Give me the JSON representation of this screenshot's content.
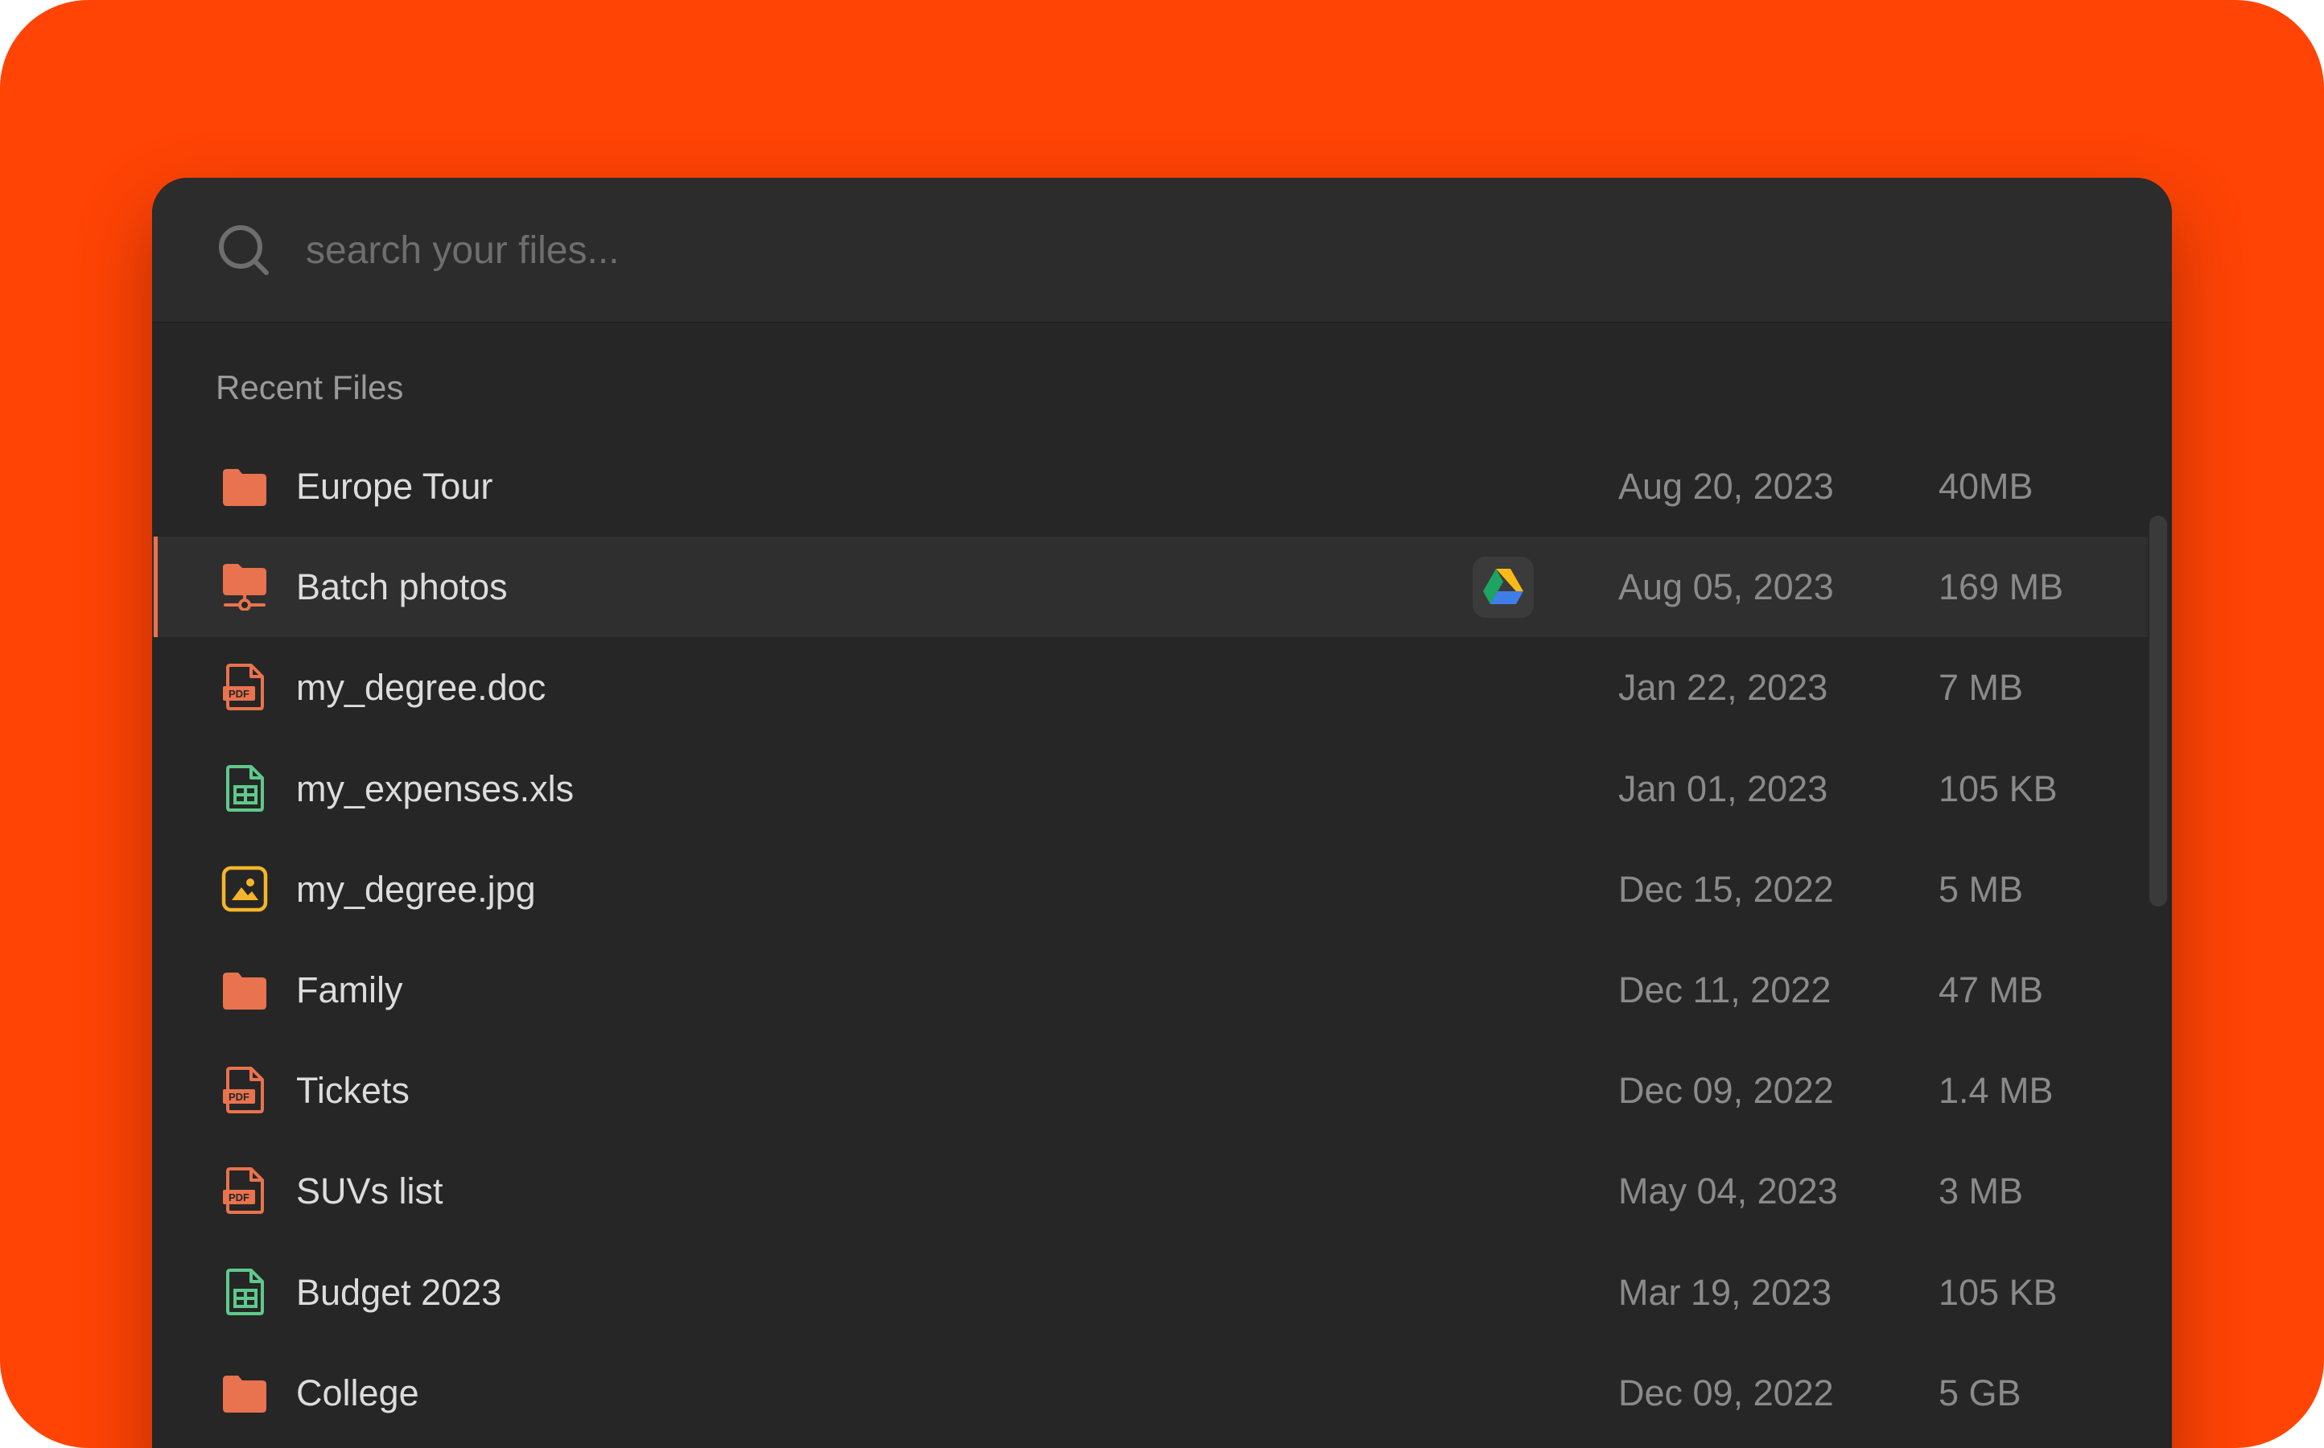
{
  "search": {
    "placeholder": "search your files...",
    "value": ""
  },
  "section": {
    "title": "Recent Files"
  },
  "colors": {
    "background": "#ff4405",
    "panel": "#262626",
    "accent": "#e8734e",
    "spreadsheet": "#5fc98b",
    "image": "#f5b52a"
  },
  "files": [
    {
      "name": "Europe Tour",
      "date": "Aug 20, 2023",
      "size": "40MB",
      "icon": "folder-icon"
    },
    {
      "name": "Batch photos",
      "date": "Aug 05, 2023",
      "size": "169 MB",
      "icon": "shared-folder-icon",
      "selected": true,
      "badge": "google-drive-icon"
    },
    {
      "name": "my_degree.doc",
      "date": "Jan 22, 2023",
      "size": "7 MB",
      "icon": "pdf-file-icon",
      "icon_text": "PDF"
    },
    {
      "name": "my_expenses.xls",
      "date": "Jan 01, 2023",
      "size": "105 KB",
      "icon": "spreadsheet-file-icon"
    },
    {
      "name": "my_degree.jpg",
      "date": "Dec 15, 2022",
      "size": "5 MB",
      "icon": "image-file-icon"
    },
    {
      "name": "Family",
      "date": "Dec 11, 2022",
      "size": "47 MB",
      "icon": "folder-icon"
    },
    {
      "name": "Tickets",
      "date": "Dec 09, 2022",
      "size": "1.4 MB",
      "icon": "pdf-file-icon",
      "icon_text": "PDF"
    },
    {
      "name": "SUVs list",
      "date": "May 04, 2023",
      "size": "3 MB",
      "icon": "pdf-file-icon",
      "icon_text": "PDF"
    },
    {
      "name": "Budget 2023",
      "date": "Mar 19, 2023",
      "size": "105 KB",
      "icon": "spreadsheet-file-icon"
    },
    {
      "name": "College",
      "date": "Dec 09, 2022",
      "size": "5 GB",
      "icon": "folder-icon"
    }
  ]
}
